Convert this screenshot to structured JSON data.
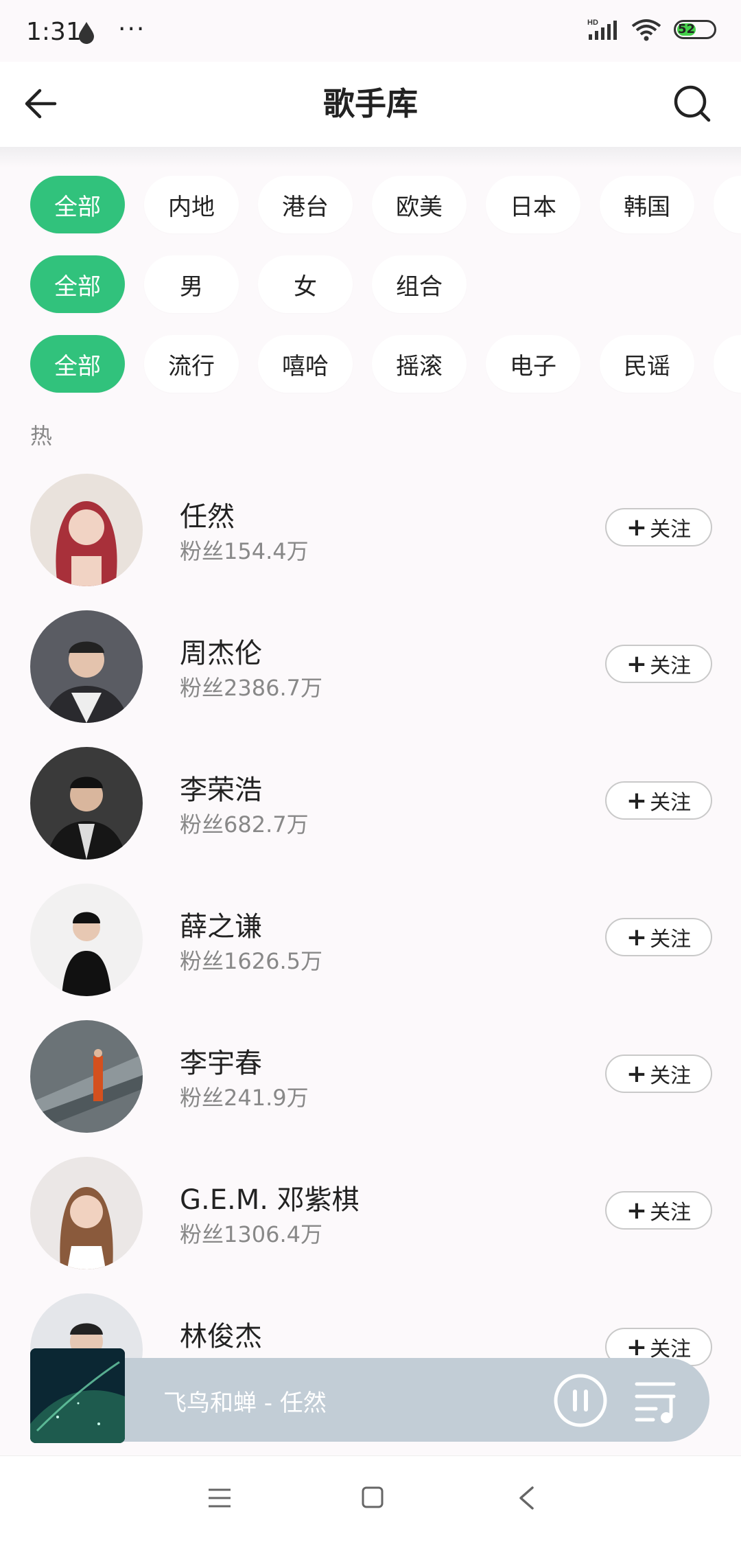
{
  "status_bar": {
    "time": "1:31",
    "dots": "···",
    "battery": "52"
  },
  "header": {
    "title": "歌手库"
  },
  "filters": {
    "region": [
      "全部",
      "内地",
      "港台",
      "欧美",
      "日本",
      "韩国"
    ],
    "gender": [
      "全部",
      "男",
      "女",
      "组合"
    ],
    "genre": [
      "全部",
      "流行",
      "嘻哈",
      "摇滚",
      "电子",
      "民谣"
    ]
  },
  "section_label": "热",
  "artists": [
    {
      "name": "任然",
      "fans": "粉丝154.4万",
      "follow": "关注"
    },
    {
      "name": "周杰伦",
      "fans": "粉丝2386.7万",
      "follow": "关注"
    },
    {
      "name": "李荣浩",
      "fans": "粉丝682.7万",
      "follow": "关注"
    },
    {
      "name": "薛之谦",
      "fans": "粉丝1626.5万",
      "follow": "关注"
    },
    {
      "name": "李宇春",
      "fans": "粉丝241.9万",
      "follow": "关注"
    },
    {
      "name": "G.E.M. 邓紫棋",
      "fans": "粉丝1306.4万",
      "follow": "关注"
    },
    {
      "name": "林俊杰",
      "fans": "",
      "follow": "关注"
    }
  ],
  "player": {
    "now_playing": "飞鸟和蝉 - 任然"
  },
  "colors": {
    "accent": "#31c27c",
    "background": "#fcf9fb",
    "player_bg": "#c2cdd6"
  }
}
